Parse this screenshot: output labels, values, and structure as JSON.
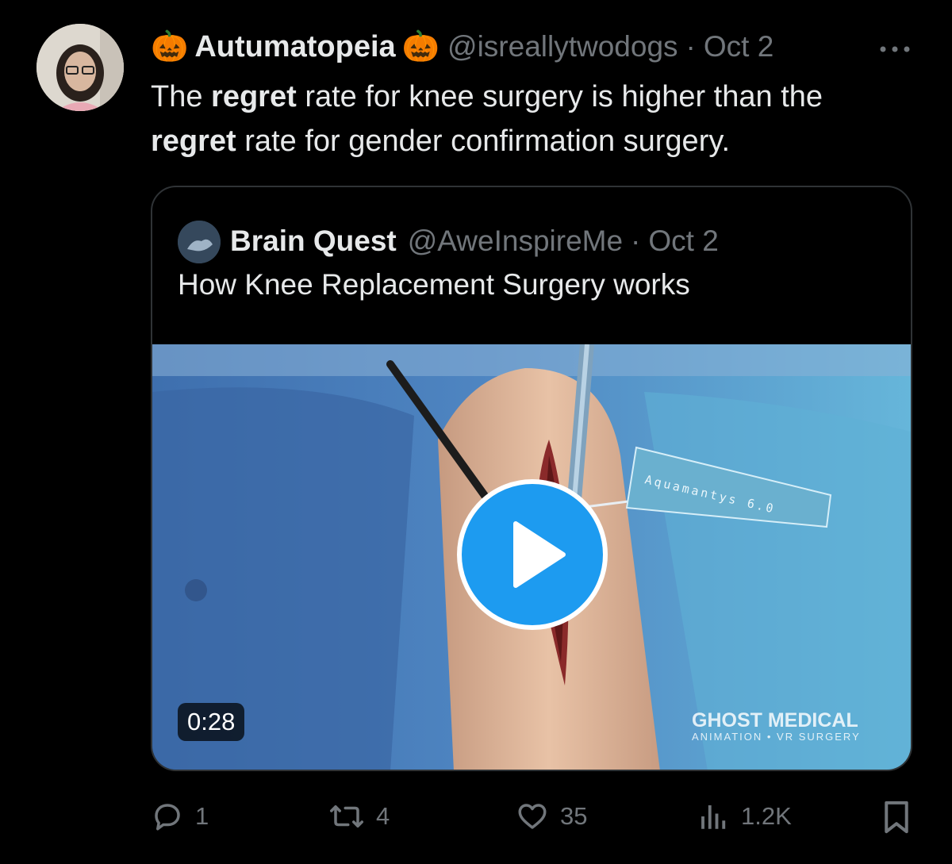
{
  "tweet": {
    "display_name": "Autumatopeia",
    "emoji_left": "🎃",
    "emoji_right": "🎃",
    "handle": "@isreallytwodogs",
    "separator": "·",
    "date": "Oct 2",
    "text_parts": [
      "The ",
      "regret",
      " rate for knee surgery is higher than the ",
      "regret",
      " rate for gender confirmation surgery."
    ]
  },
  "quote": {
    "display_name": "Brain Quest",
    "handle": "@AweInspireMe",
    "separator": "·",
    "date": "Oct 2",
    "text": "How Knee Replacement Surgery works",
    "video": {
      "duration": "0:28",
      "overlay_label": "Aquamantys 6.0",
      "watermark_top": "GHOST MEDICAL",
      "watermark_bottom": "ANIMATION • VR SURGERY"
    }
  },
  "actions": {
    "replies": "1",
    "reposts": "4",
    "likes": "35",
    "views": "1.2K"
  },
  "icons": [
    "more-icon",
    "reply-icon",
    "repost-icon",
    "like-icon",
    "views-icon",
    "bookmark-icon",
    "play-icon"
  ]
}
